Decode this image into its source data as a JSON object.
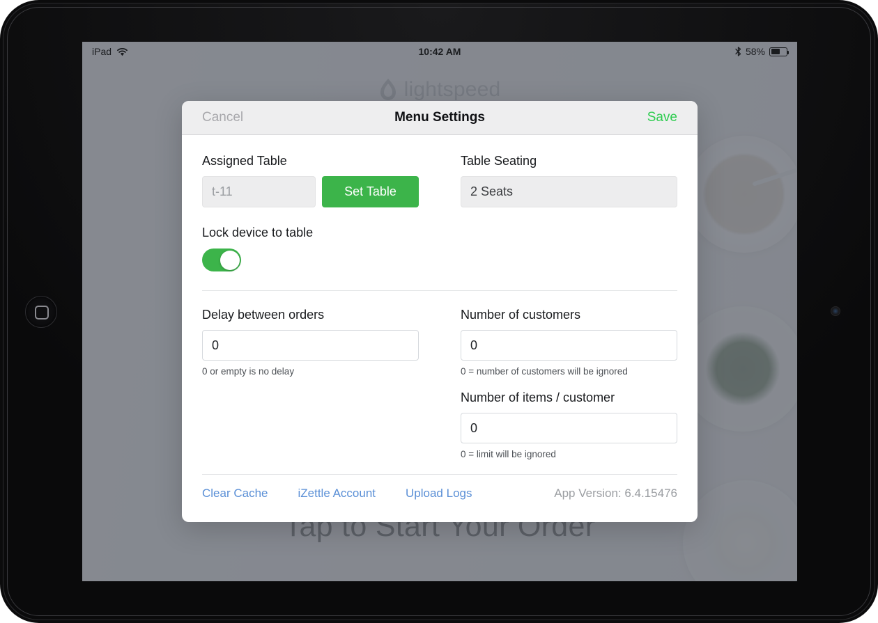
{
  "status_bar": {
    "device_label": "iPad",
    "wifi_icon": "wifi-icon",
    "time": "10:42 AM",
    "bluetooth_icon": "bluetooth-icon",
    "battery_percent": "58%",
    "battery_level": 58
  },
  "kiosk": {
    "logo_text": "lightspeed",
    "logo_mark": "flame-icon",
    "cta": "Tap to Start Your Order"
  },
  "modal": {
    "cancel_label": "Cancel",
    "title": "Menu Settings",
    "save_label": "Save",
    "assigned_table": {
      "label": "Assigned Table",
      "value": "t-11",
      "placeholder": "t-11",
      "button_label": "Set Table"
    },
    "table_seating": {
      "label": "Table Seating",
      "value": "2 Seats"
    },
    "lock_device": {
      "label": "Lock device to table",
      "enabled": true
    },
    "delay_between_orders": {
      "label": "Delay between orders",
      "value": "0",
      "hint": "0 or empty is no delay"
    },
    "number_of_customers": {
      "label": "Number of customers",
      "value": "0",
      "hint": "0 = number of customers will be ignored"
    },
    "items_per_customer": {
      "label": "Number of items / customer",
      "value": "0",
      "hint": "0 = limit will be ignored"
    },
    "footer": {
      "links": [
        {
          "label": "Clear Cache"
        },
        {
          "label": "iZettle Account"
        },
        {
          "label": "Upload Logs"
        }
      ],
      "app_version": "App Version: 6.4.15476"
    }
  },
  "colors": {
    "accent_green": "#3cb44a",
    "save_green": "#2ecc50",
    "link_blue": "#5a8fd6",
    "backdrop": "#6d7179"
  }
}
